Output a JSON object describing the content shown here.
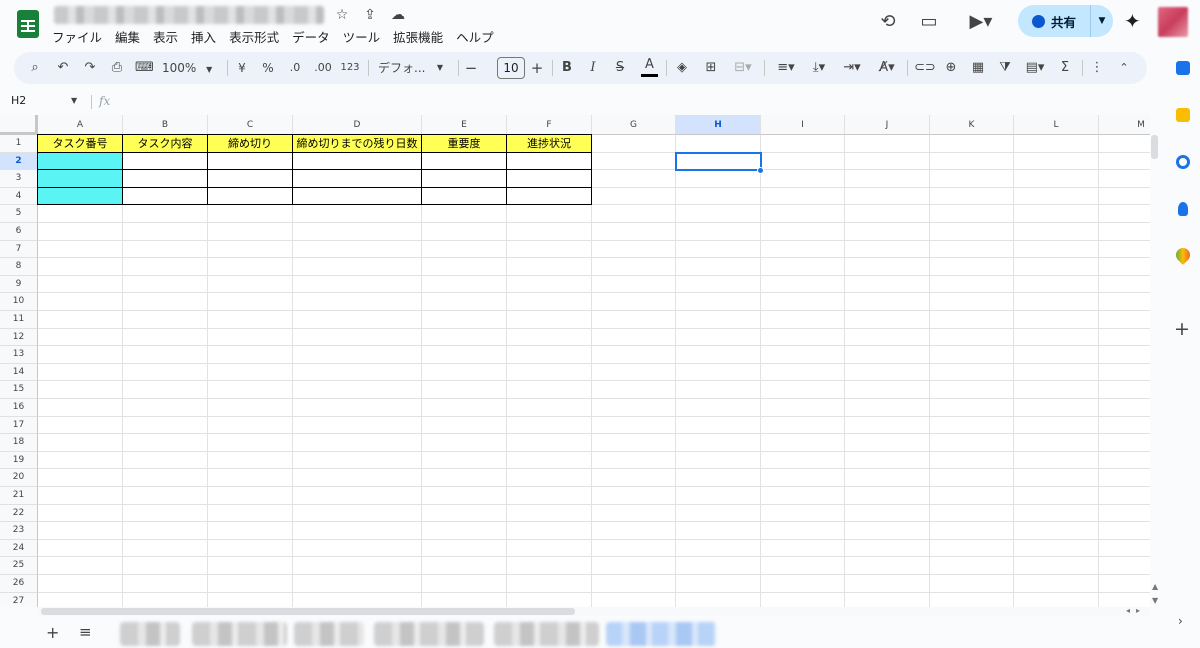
{
  "header": {
    "title_icons": [
      "☆",
      "⇪",
      "☁"
    ],
    "menu": [
      "ファイル",
      "編集",
      "表示",
      "挿入",
      "表示形式",
      "データ",
      "ツール",
      "拡張機能",
      "ヘルプ"
    ],
    "share_label": "共有"
  },
  "toolbar": {
    "zoom": "100%",
    "currency": "¥",
    "percent": "%",
    "dec_decrease": ".0",
    "dec_increase": ".00",
    "number_format": "123",
    "font": "デフォ...",
    "font_size": "10",
    "bold": "B",
    "italic": "I",
    "strike": "S",
    "text_color": "A",
    "sum": "Σ"
  },
  "formula_bar": {
    "name_box": "H2",
    "fx": "fx"
  },
  "grid": {
    "columns": [
      "A",
      "B",
      "C",
      "D",
      "E",
      "F",
      "G",
      "H",
      "I",
      "J",
      "K",
      "L",
      "M"
    ],
    "rows": [
      "1",
      "2",
      "3",
      "4",
      "5",
      "6",
      "7",
      "8",
      "9",
      "10",
      "11",
      "12",
      "13",
      "14",
      "15",
      "16",
      "17",
      "18",
      "19",
      "20",
      "21",
      "22",
      "23",
      "24",
      "25",
      "26",
      "27"
    ],
    "selected_cell": "H2",
    "headers": [
      "タスク番号",
      "タスク内容",
      "締め切り",
      "締め切りまでの残り日数",
      "重要度",
      "進捗状況"
    ],
    "colors": {
      "header_fill": "#ffff55",
      "id_fill": "#5af4f4",
      "selection": "#1a73e8"
    }
  },
  "sheets": {
    "add_label": "+",
    "list_label": "≡"
  }
}
